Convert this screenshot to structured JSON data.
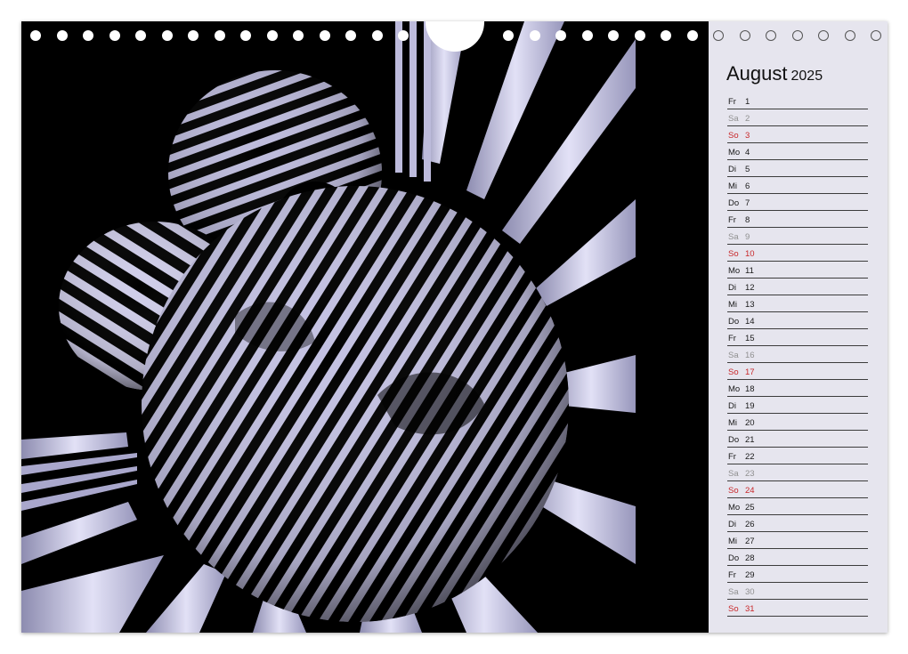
{
  "calendar": {
    "month": "August",
    "year": "2025",
    "days": [
      {
        "wd": "Fr",
        "d": "1",
        "type": "wk"
      },
      {
        "wd": "Sa",
        "d": "2",
        "type": "sat"
      },
      {
        "wd": "So",
        "d": "3",
        "type": "sun"
      },
      {
        "wd": "Mo",
        "d": "4",
        "type": "wk"
      },
      {
        "wd": "Di",
        "d": "5",
        "type": "wk"
      },
      {
        "wd": "Mi",
        "d": "6",
        "type": "wk"
      },
      {
        "wd": "Do",
        "d": "7",
        "type": "wk"
      },
      {
        "wd": "Fr",
        "d": "8",
        "type": "wk"
      },
      {
        "wd": "Sa",
        "d": "9",
        "type": "sat"
      },
      {
        "wd": "So",
        "d": "10",
        "type": "sun"
      },
      {
        "wd": "Mo",
        "d": "11",
        "type": "wk"
      },
      {
        "wd": "Di",
        "d": "12",
        "type": "wk"
      },
      {
        "wd": "Mi",
        "d": "13",
        "type": "wk"
      },
      {
        "wd": "Do",
        "d": "14",
        "type": "wk"
      },
      {
        "wd": "Fr",
        "d": "15",
        "type": "wk"
      },
      {
        "wd": "Sa",
        "d": "16",
        "type": "sat"
      },
      {
        "wd": "So",
        "d": "17",
        "type": "sun"
      },
      {
        "wd": "Mo",
        "d": "18",
        "type": "wk"
      },
      {
        "wd": "Di",
        "d": "19",
        "type": "wk"
      },
      {
        "wd": "Mi",
        "d": "20",
        "type": "wk"
      },
      {
        "wd": "Do",
        "d": "21",
        "type": "wk"
      },
      {
        "wd": "Fr",
        "d": "22",
        "type": "wk"
      },
      {
        "wd": "Sa",
        "d": "23",
        "type": "sat"
      },
      {
        "wd": "So",
        "d": "24",
        "type": "sun"
      },
      {
        "wd": "Mo",
        "d": "25",
        "type": "wk"
      },
      {
        "wd": "Di",
        "d": "26",
        "type": "wk"
      },
      {
        "wd": "Mi",
        "d": "27",
        "type": "wk"
      },
      {
        "wd": "Do",
        "d": "28",
        "type": "wk"
      },
      {
        "wd": "Fr",
        "d": "29",
        "type": "wk"
      },
      {
        "wd": "Sa",
        "d": "30",
        "type": "sat"
      },
      {
        "wd": "So",
        "d": "31",
        "type": "sun"
      }
    ]
  },
  "artwork": {
    "subject": "op-art-striped-sculpture-image",
    "colors": {
      "background": "#000000",
      "stripe": "#c9c8e6",
      "panel": "#e6e5ee",
      "sunday": "#c8282a",
      "saturday": "#909090"
    }
  }
}
